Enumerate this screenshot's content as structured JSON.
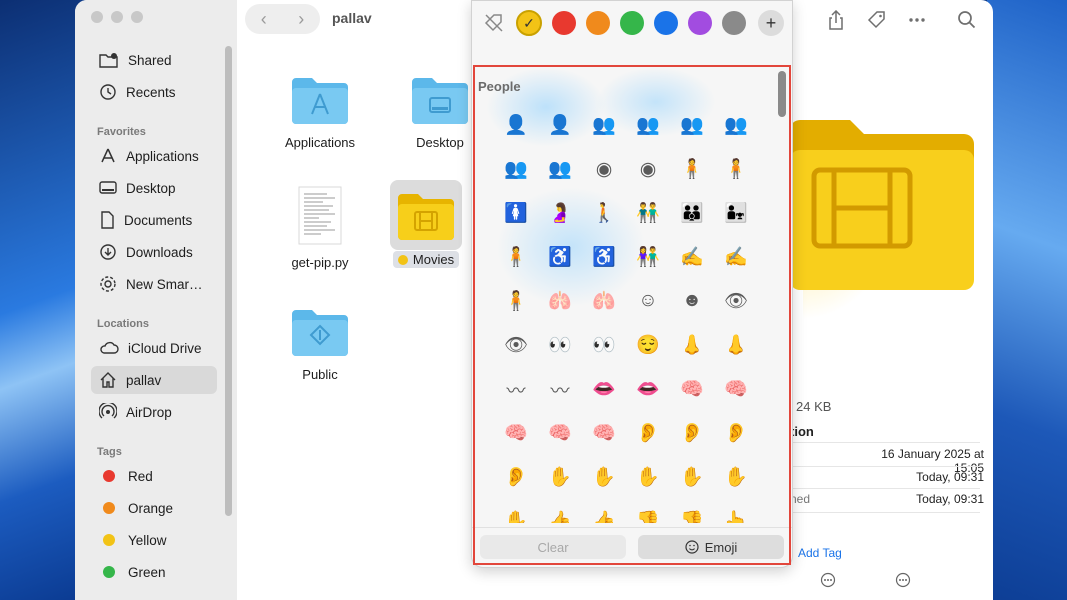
{
  "window": {
    "title": "pallav"
  },
  "sidebar": {
    "top_items": [
      {
        "label": "Shared",
        "icon": "shared-folder-icon"
      },
      {
        "label": "Recents",
        "icon": "clock-icon"
      }
    ],
    "favorites_header": "Favorites",
    "favorites": [
      {
        "label": "Applications",
        "icon": "applications-icon"
      },
      {
        "label": "Desktop",
        "icon": "desktop-icon"
      },
      {
        "label": "Documents",
        "icon": "document-icon"
      },
      {
        "label": "Downloads",
        "icon": "download-icon"
      },
      {
        "label": "New Smar…",
        "icon": "gear-icon"
      }
    ],
    "locations_header": "Locations",
    "locations": [
      {
        "label": "iCloud Drive",
        "icon": "cloud-icon"
      },
      {
        "label": "pallav",
        "icon": "home-icon"
      },
      {
        "label": "AirDrop",
        "icon": "airdrop-icon"
      }
    ],
    "tags_header": "Tags",
    "tags": [
      {
        "label": "Red",
        "color": "#e8392f"
      },
      {
        "label": "Orange",
        "color": "#f08a1c"
      },
      {
        "label": "Yellow",
        "color": "#f2c316"
      },
      {
        "label": "Green",
        "color": "#35b64a"
      }
    ]
  },
  "files": [
    {
      "label": "Applications",
      "kind": "folder-blue"
    },
    {
      "label": "Desktop",
      "kind": "folder-blue"
    },
    {
      "label": "get-pip.py",
      "kind": "text-file"
    },
    {
      "label": "Movies",
      "kind": "folder-yellow",
      "tag_color": "#f2c316"
    },
    {
      "label": "Public",
      "kind": "folder-blue"
    }
  ],
  "info": {
    "size": "24 KB",
    "section": "tion",
    "rows": [
      {
        "label": "",
        "value": "16 January 2025 at 15:05"
      },
      {
        "label": "",
        "value": "Today, 09:31"
      },
      {
        "label": "ned",
        "value": "Today, 09:31"
      }
    ],
    "add_tag": "Add Tag"
  },
  "popover": {
    "colors": [
      {
        "name": "no-color",
        "color": "#f6f6f6"
      },
      {
        "name": "yellow",
        "color": "#f2c316",
        "selected": true
      },
      {
        "name": "red",
        "color": "#e8392f"
      },
      {
        "name": "orange",
        "color": "#f08a1c"
      },
      {
        "name": "green",
        "color": "#35b64a"
      },
      {
        "name": "blue",
        "color": "#1a73e8"
      },
      {
        "name": "purple",
        "color": "#a24ce0"
      },
      {
        "name": "gray",
        "color": "#8a8a8a"
      }
    ],
    "add_label": "+",
    "category": "People",
    "symbols": [
      "👤",
      "👤",
      "👥",
      "👥",
      "👥",
      "👥",
      "👥",
      "👥",
      "◉",
      "◉",
      "🧍",
      "🧍",
      "🚺",
      "🤰",
      "🚶",
      "👬",
      "👪",
      "👨‍👧",
      "🧍",
      "♿",
      "♿",
      "👫",
      "✍",
      "✍",
      "🧍",
      "🫁",
      "🫁",
      "☺",
      "☻",
      "👁",
      "👁",
      "👀",
      "👀",
      "😌",
      "👃",
      "👃",
      "〰",
      "〰",
      "👄",
      "👄",
      "🧠",
      "🧠",
      "🧠",
      "🧠",
      "🧠",
      "👂",
      "👂",
      "👂",
      "👂",
      "✋",
      "✋",
      "✋",
      "✋",
      "✋",
      "✋",
      "👍",
      "👍",
      "👎",
      "👎",
      "👆"
    ],
    "clear_label": "Clear",
    "emoji_label": "Emoji"
  }
}
